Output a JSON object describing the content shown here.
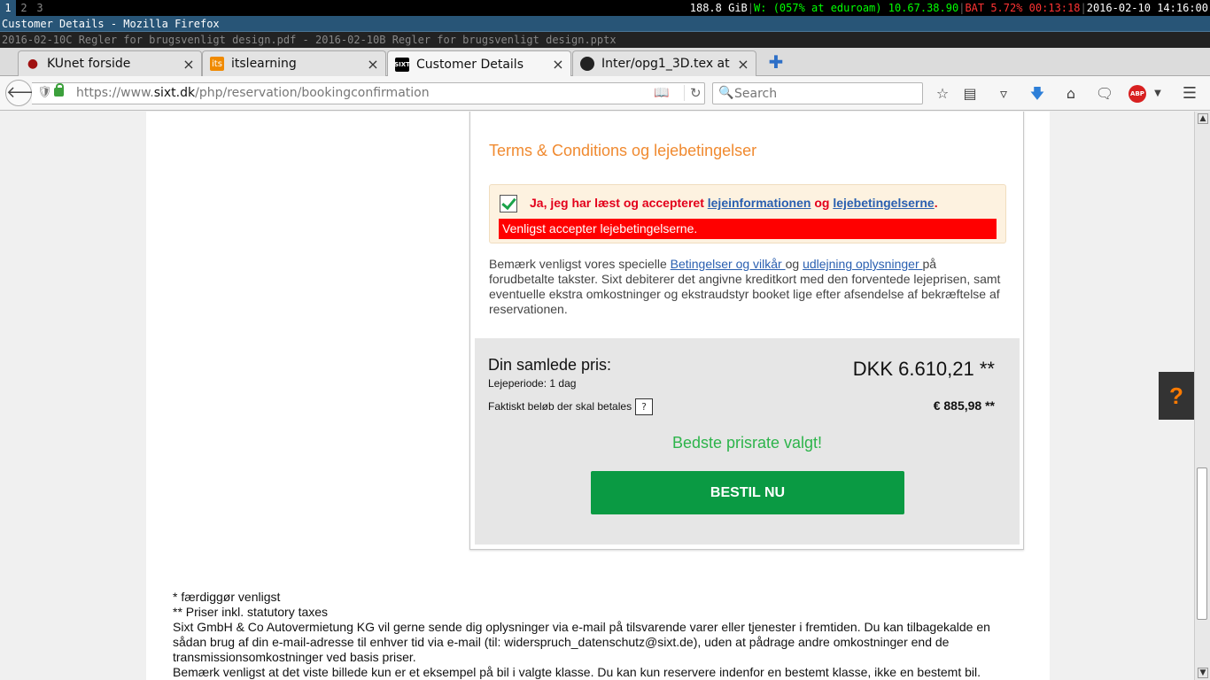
{
  "statusbar": {
    "workspaces": [
      "1",
      "2",
      "3"
    ],
    "disk": "188.8 GiB",
    "wifi": "W: (057% at eduroam) 10.67.38.90",
    "battery": "BAT 5.72% 00:13:18",
    "datetime": "2016-02-10 14:16:00",
    "separator": "|"
  },
  "window": {
    "title": "Customer Details - Mozilla Firefox",
    "subtitle": "2016-02-10C Regler for brugsvenligt design.pdf - 2016-02-10B Regler for brugsvenligt design.pptx"
  },
  "tabs": [
    {
      "label": "KUnet forside",
      "icon": "kunet-icon"
    },
    {
      "label": "itslearning",
      "icon": "itslearning-icon",
      "fav_text": "its"
    },
    {
      "label": "Customer Details",
      "icon": "sixt-icon",
      "fav_text": "SIXT",
      "active": true
    },
    {
      "label": "Inter/opg1_3D.tex at ...",
      "icon": "github-icon"
    }
  ],
  "tab_close": "×",
  "navbar": {
    "url_prefix": "https://www.",
    "url_host": "sixt.dk",
    "url_path": "/php/reservation/bookingconfirmation",
    "search_placeholder": "Search"
  },
  "page": {
    "tc_heading": "Terms & Conditions og lejebetingelser",
    "agree": {
      "text_before": "Ja, jeg har læst og accepteret ",
      "link1": "lejeinformationen",
      "text_mid": " og ",
      "link2": "lejebetingelserne",
      "text_after": ".",
      "checked": true,
      "error": "Venligst accepter lejebetingelserne."
    },
    "notice": {
      "before": "Bemærk venligst vores specielle ",
      "link1": "Betingelser og vilkår ",
      "mid": "og ",
      "link2": "udlejning oplysninger ",
      "after": "på forudbetalte takster. Sixt debiterer det angivne kreditkort med den forventede lejeprisen, samt eventuelle ekstra omkostninger og ekstraudstyr booket lige efter afsendelse af bekræftelse af reservationen."
    },
    "price": {
      "label": "Din samlede pris:",
      "period": "Lejeperiode: 1 dag",
      "total": "DKK 6.610,21 **",
      "actual_label": "Faktiskt beløb der skal betales",
      "help": "?",
      "actual_amount": "€ 885,98 **",
      "best_rate": "Bedste prisrate valgt!",
      "order_button": "BESTIL NU"
    },
    "footer": [
      "* færdiggør venligst",
      "** Priser inkl. statutory taxes",
      "Sixt GmbH & Co Autovermietung KG vil gerne sende dig oplysninger via e-mail på tilsvarende varer eller tjenester i fremtiden. Du kan tilbagekalde en sådan brug af din e-mail-adresse til enhver tid via e-mail (til: widerspruch_datenschutz@sixt.de), uden at pådrage andre omkostninger end de transmissionsomkostninger ved basis priser.",
      "Bemærk venligst at det viste billede kun er et eksempel på bil i valgte klasse. Du kan kun reservere indenfor en bestemt klasse, ikke en bestemt bil."
    ],
    "help_widget": "?"
  }
}
